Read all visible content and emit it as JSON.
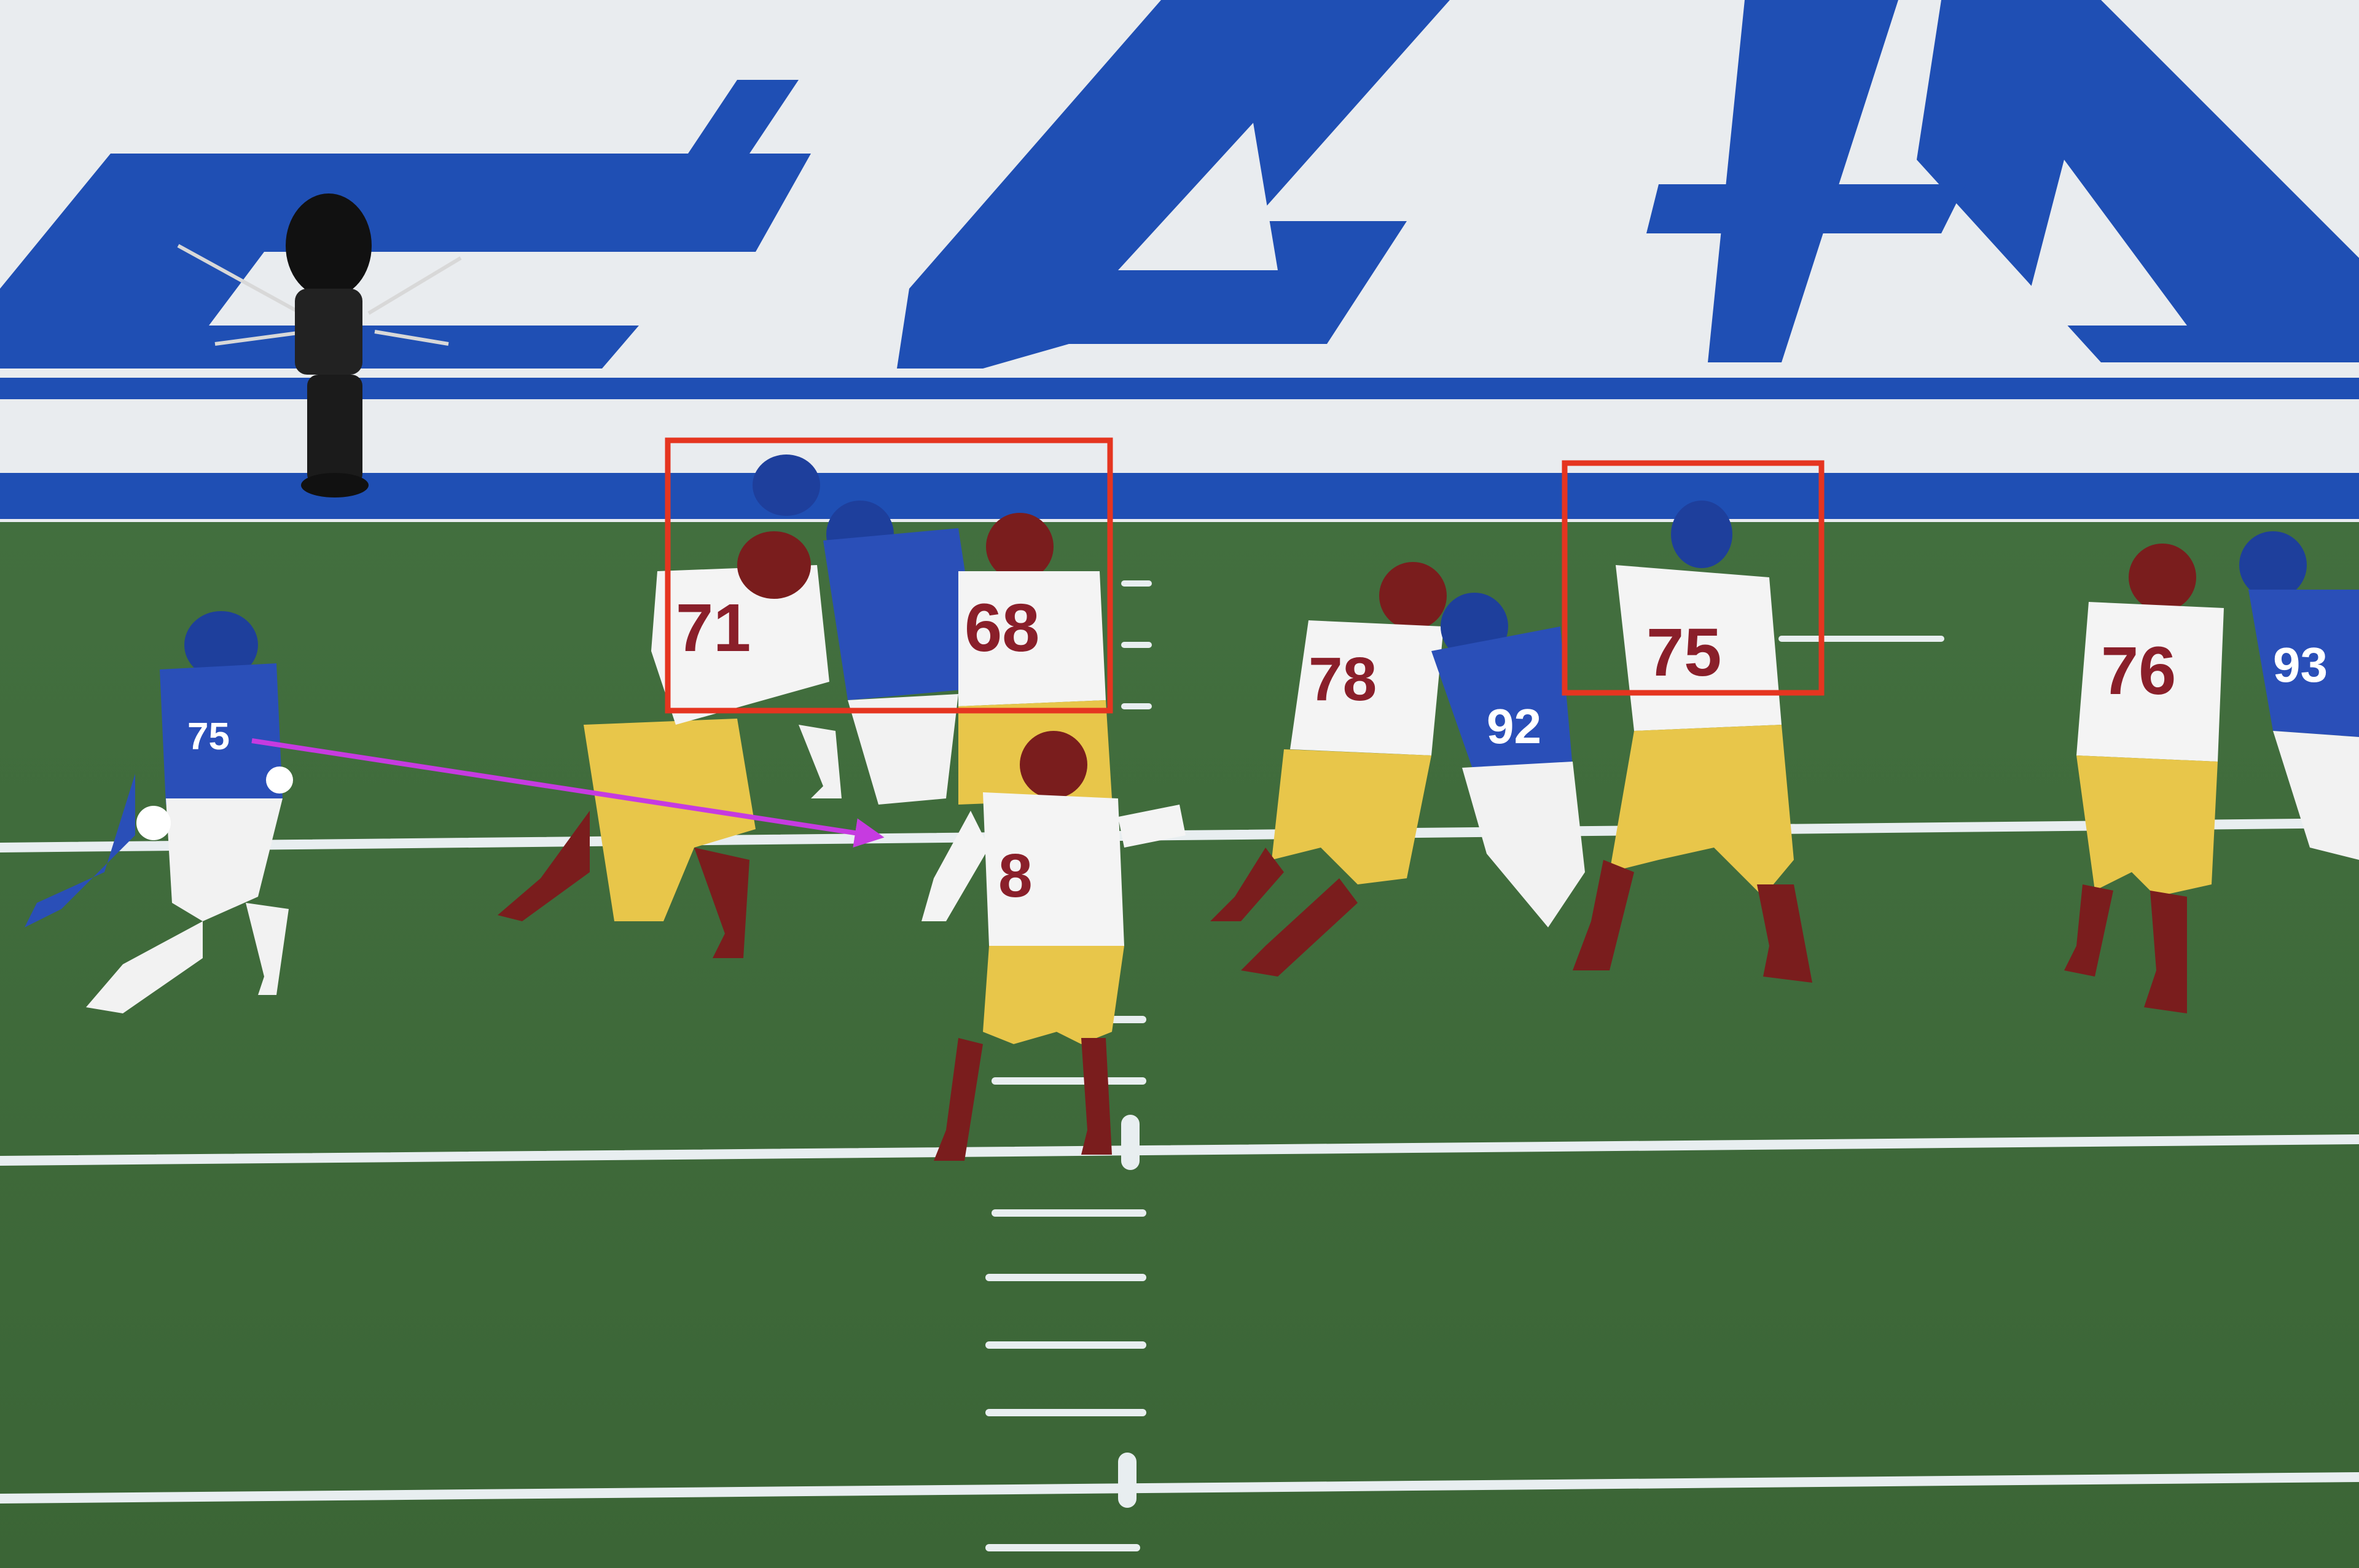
{
  "scene": {
    "description_tags": [
      "football-field",
      "end-zone-lettering",
      "skycam",
      "offensive-line",
      "defensive-line",
      "quarterback",
      "telestrator"
    ],
    "colors": {
      "turf": "#3f6a3a",
      "turf_dark": "#36602f",
      "endzone_blue": "#1f4fb4",
      "endzone_white": "#e9ecef",
      "yard_line": "#e8eef0",
      "highlight_box": "#e53520",
      "arrow": "#c63be0",
      "offense_jersey": "#f4f4f4",
      "offense_pants": "#e8c64a",
      "offense_helmet": "#7a1d1d",
      "defense_jersey": "#2a4fb8",
      "defense_pants": "#f2f2f2",
      "number_burgundy": "#8a1f2a"
    }
  },
  "players": {
    "offense": [
      {
        "role": "left-tackle",
        "number": "71"
      },
      {
        "role": "left-guard",
        "number": "68"
      },
      {
        "role": "center-right-guard",
        "number": "78"
      },
      {
        "role": "right-guard",
        "number": "75"
      },
      {
        "role": "right-tackle",
        "number": "76"
      },
      {
        "role": "quarterback",
        "number": "8"
      }
    ],
    "defense": [
      {
        "role": "edge-rusher",
        "number": "75"
      },
      {
        "role": "interior-lineman",
        "number": "92"
      },
      {
        "role": "edge-right",
        "number": "93"
      }
    ]
  },
  "annotations": {
    "boxes": [
      {
        "name": "highlight-box-left",
        "label": ""
      },
      {
        "name": "highlight-box-right",
        "label": ""
      }
    ],
    "arrow": {
      "name": "pursuit-arrow"
    }
  }
}
